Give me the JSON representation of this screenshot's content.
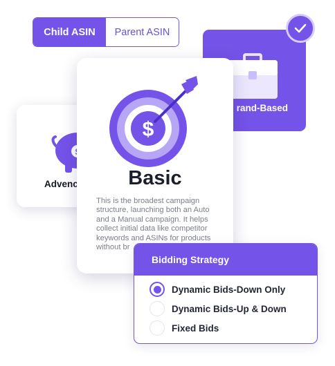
{
  "asin_toggle": {
    "options": [
      "Child ASIN",
      "Parent ASIN"
    ],
    "selected": "Child ASIN"
  },
  "cards": {
    "brand": {
      "label": "Brand-Based",
      "visible_label": "rand-Based",
      "selected": true,
      "icon": "briefcase-icon"
    },
    "advanced": {
      "label": "Advanced",
      "visible_label": "Advenc",
      "icon": "piggy-bank-icon"
    },
    "basic": {
      "title": "Basic",
      "description": "This is the broadest campaign structure, launching both an Auto and a Manual campaign. It helps collect initial data like competitor keywords and ASINs for products without br",
      "icon": "target-dollar-icon"
    }
  },
  "bidding": {
    "title": "Bidding Strategy",
    "options": [
      {
        "label": "Dynamic Bids-Down Only",
        "selected": true
      },
      {
        "label": "Dynamic Bids-Up & Down",
        "selected": false
      },
      {
        "label": "Fixed Bids",
        "selected": false
      }
    ]
  },
  "colors": {
    "accent": "#7453e8",
    "accent_light": "#d8ccff",
    "text_dark": "#1b1f29",
    "text_muted": "#7b7f88"
  }
}
